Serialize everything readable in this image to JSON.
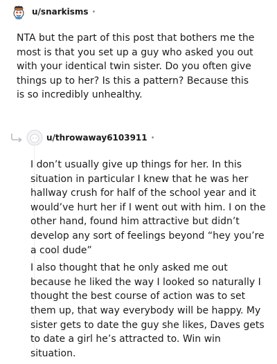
{
  "comment": {
    "username": "u/snarkisms",
    "body": "NTA but the part of this post that bothers me the most is that you set up a guy who asked you out with your identical twin sister. Do you often give things up to her? Is this a pattern? Because this is so incredibly unhealthy.",
    "avatar_icon": "snoo-avatar-icon"
  },
  "reply": {
    "username": "u/throwaway6103911",
    "paragraphs": [
      "I don’t usually give up things for her. In this situation in particular I knew that he was her hallway crush for half of the school year and it would’ve hurt her if I went out with him. I on the other hand, found him attractive but didn’t develop any sort of feelings beyond “hey you’re a cool dude”",
      "I also thought that he only asked me out because he liked the way I looked so naturally I thought the best course of action was to set them up, that way everybody will be happy. My sister gets to date the guy she likes, Daves gets to date a girl he’s attracted to. Win win situation."
    ],
    "avatar_icon": "default-avatar-icon",
    "reply_icon": "reply-arrow-icon"
  },
  "separator": "•",
  "colors": {
    "text": "#1a1a1b",
    "meta": "#878a8c",
    "thread": "#edeff1"
  }
}
